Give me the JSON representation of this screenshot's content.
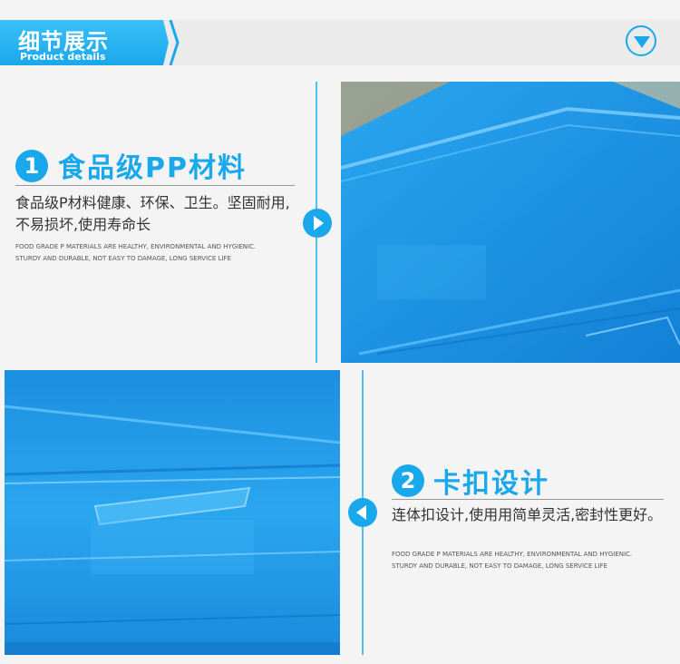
{
  "header": {
    "title": "细节展示",
    "subtitle": "Product details",
    "down_icon": "chevron-down-circle-icon"
  },
  "colors": {
    "accent": "#1aa8ec",
    "line": "#4ec3f2",
    "background": "#f4f4f4",
    "text": "#333333"
  },
  "feature1": {
    "number": "1",
    "title": "食品级PP材料",
    "desc": "食品级P材料健康、环保、卫生。坚固耐用,不易损坏,使用寿命长",
    "en_line1": "FOOD GRADE P MATERIALS ARE HEALTHY, ENVIRONMENTAL AND HYGIENIC.",
    "en_line2": "STURDY AND DURABLE, NOT EASY TO DAMAGE, LONG SERVICE LIFE",
    "arrow_icon": "arrow-right-icon"
  },
  "feature2": {
    "number": "2",
    "title": "卡扣设计",
    "desc": "连体扣设计,使用用简单灵活,密封性更好。",
    "en_line1": "FOOD GRADE P MATERIALS ARE HEALTHY, ENVIRONMENTAL AND HYGIENIC.",
    "en_line2": "STURDY AND DURABLE, NOT EASY TO DAMAGE, LONG SERVICE LIFE",
    "arrow_icon": "arrow-left-icon"
  }
}
